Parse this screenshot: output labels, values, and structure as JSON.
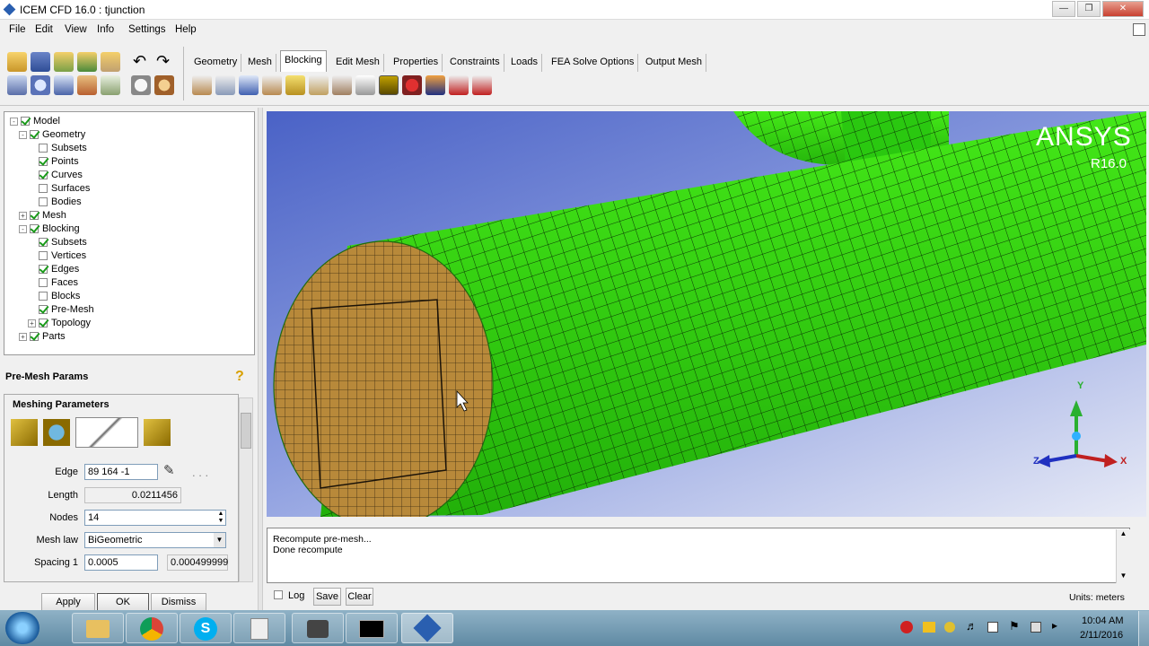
{
  "window": {
    "title": "ICEM CFD 16.0 : tjunction"
  },
  "menu": [
    "File",
    "Edit",
    "View",
    "Info",
    "Settings",
    "Help"
  ],
  "tabs": [
    "Geometry",
    "Mesh",
    "Blocking",
    "Edit Mesh",
    "Properties",
    "Constraints",
    "Loads",
    "FEA Solve Options",
    "Output Mesh"
  ],
  "selected_tab": "Blocking",
  "tree": [
    {
      "label": "Model",
      "level": 0,
      "expander": "-",
      "checked": true
    },
    {
      "label": "Geometry",
      "level": 1,
      "expander": "-",
      "checked": true
    },
    {
      "label": "Subsets",
      "level": 2,
      "expander": "",
      "checked": false
    },
    {
      "label": "Points",
      "level": 2,
      "expander": "",
      "checked": true
    },
    {
      "label": "Curves",
      "level": 2,
      "expander": "",
      "checked": true
    },
    {
      "label": "Surfaces",
      "level": 2,
      "expander": "",
      "checked": false
    },
    {
      "label": "Bodies",
      "level": 2,
      "expander": "",
      "checked": false
    },
    {
      "label": "Mesh",
      "level": 1,
      "expander": "+",
      "checked": true
    },
    {
      "label": "Blocking",
      "level": 1,
      "expander": "-",
      "checked": true
    },
    {
      "label": "Subsets",
      "level": 2,
      "expander": "",
      "checked": true
    },
    {
      "label": "Vertices",
      "level": 2,
      "expander": "",
      "checked": false
    },
    {
      "label": "Edges",
      "level": 2,
      "expander": "",
      "checked": true
    },
    {
      "label": "Faces",
      "level": 2,
      "expander": "",
      "checked": false
    },
    {
      "label": "Blocks",
      "level": 2,
      "expander": "",
      "checked": false
    },
    {
      "label": "Pre-Mesh",
      "level": 2,
      "expander": "",
      "checked": true
    },
    {
      "label": "Topology",
      "level": 2,
      "expander": "+",
      "checked": true
    },
    {
      "label": "Parts",
      "level": 1,
      "expander": "+",
      "checked": true
    }
  ],
  "params": {
    "panel_title": "Pre-Mesh Params",
    "section_title": "Meshing Parameters",
    "edge_label": "Edge",
    "edge_value": "89 164 -1",
    "length_label": "Length",
    "length_value": "0.0211456",
    "nodes_label": "Nodes",
    "nodes_value": "14",
    "meshlaw_label": "Mesh law",
    "meshlaw_value": "BiGeometric",
    "spacing1_label": "Spacing 1",
    "spacing1_value": "0.0005",
    "spacing1_actual": "0.000499999",
    "apply": "Apply",
    "ok": "OK",
    "dismiss": "Dismiss"
  },
  "viewport": {
    "brand": "ANSYS",
    "version": "R16.0",
    "axis_y": "Y",
    "axis_z": "Z",
    "axis_x": "X",
    "mesh_color": "#33dd11"
  },
  "messages": {
    "lines": [
      "Recompute pre-mesh...",
      "Done recompute"
    ],
    "log_label": "Log",
    "save": "Save",
    "clear": "Clear",
    "units": "Units: meters"
  },
  "clock": {
    "time": "10:04 AM",
    "date": "2/11/2016"
  }
}
